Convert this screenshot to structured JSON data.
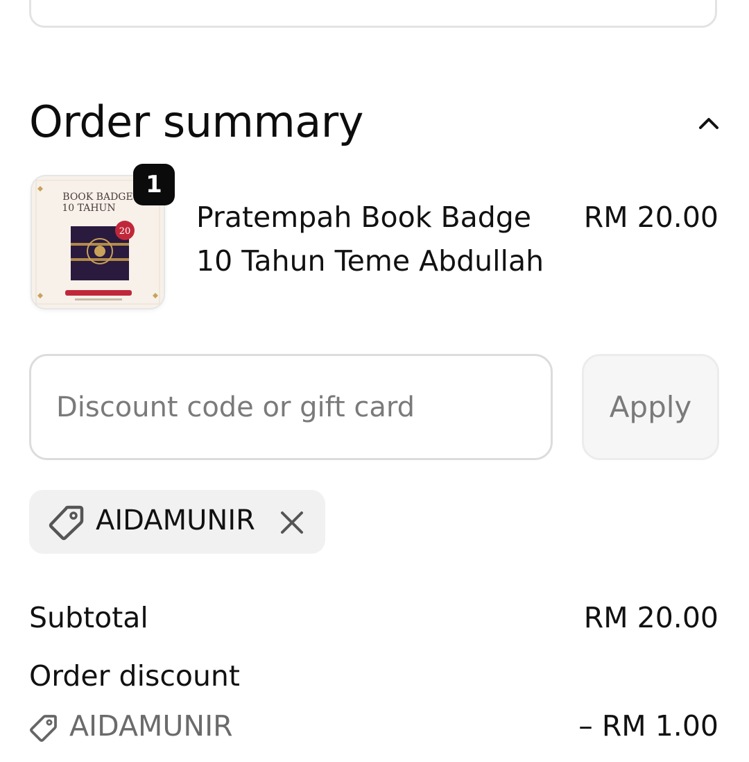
{
  "order_summary": {
    "title": "Order summary"
  },
  "line_item": {
    "quantity": "1",
    "name_line1": "Pratempah Book Badge",
    "name_line2": "10 Tahun Teme Abdullah",
    "price": "RM 20.00",
    "thumbnail": {
      "heading_line1": "BOOK BADGE",
      "heading_line2": "10 TAHUN",
      "badge_number": "20"
    }
  },
  "discount": {
    "placeholder": "Discount code or gift card",
    "apply_label": "Apply",
    "applied_code": "AIDAMUNIR"
  },
  "totals": {
    "subtotal_label": "Subtotal",
    "subtotal_value": "RM 20.00",
    "order_discount_label": "Order discount",
    "order_discount_code": "AIDAMUNIR",
    "order_discount_value": "– RM 1.00"
  },
  "icons": {
    "collapse": "chevron-up-icon",
    "tag": "tag-icon",
    "remove": "close-icon"
  },
  "colors": {
    "text": "#111111",
    "muted": "#7a7a7a",
    "border": "#dcdcdc",
    "chip_bg": "#f1f1f1",
    "badge_bg": "#0b0b0b",
    "product_accent": "#c0283a",
    "product_dark": "#2a1a3e"
  }
}
